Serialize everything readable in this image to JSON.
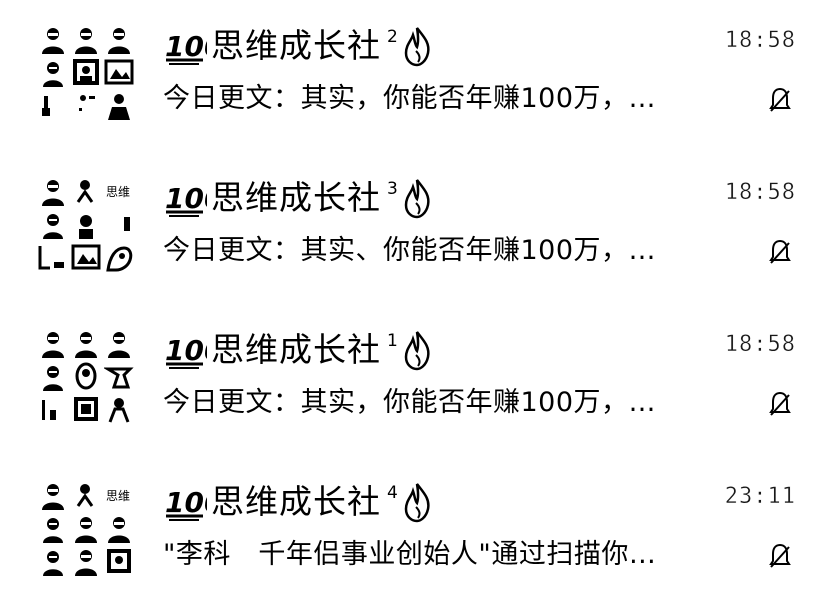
{
  "chats": [
    {
      "name": "思维成长社",
      "emoji": "100",
      "group_number": "2",
      "time": "18:58",
      "preview": "今日更文：其实，你能否年赚100万，…",
      "status_icon": "muted-bell-icon"
    },
    {
      "name": "思维成长社",
      "emoji": "100",
      "group_number": "3",
      "time": "18:58",
      "preview": "今日更文：其实、你能否年赚100万，…",
      "status_icon": "muted-bell-icon"
    },
    {
      "name": "思维成长社",
      "emoji": "100",
      "group_number": "1",
      "time": "18:58",
      "preview": "今日更文：其实，你能否年赚100万，…",
      "status_icon": "muted-bell-icon"
    },
    {
      "name": "思维成长社",
      "emoji": "100",
      "group_number": "4",
      "time": "23:11",
      "preview": "\"李科　千年侣事业创始人\"通过扫描你…",
      "status_icon": "muted-bell-icon"
    }
  ],
  "colors": {
    "background": "#ffffff",
    "foreground": "#000000"
  }
}
